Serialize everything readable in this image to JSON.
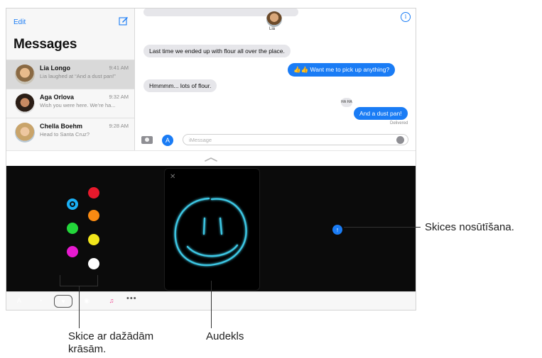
{
  "sidebar": {
    "edit_label": "Edit",
    "title": "Messages",
    "conversations": [
      {
        "name": "Lia Longo",
        "time": "9:41 AM",
        "preview": "Lia laughed at “And a dust pan!”"
      },
      {
        "name": "Aga Orlova",
        "time": "9:32 AM",
        "preview": "Wish you were here. We’re ha..."
      },
      {
        "name": "Chella Boehm",
        "time": "9:28 AM",
        "preview": "Head to Santa Cruz?"
      }
    ]
  },
  "chat": {
    "contact_name": "Lia",
    "messages": [
      {
        "text": "Last time we ended up with flour all over the place.",
        "direction": "in"
      },
      {
        "text": "👍👍 Want me to pick up anything?",
        "direction": "out"
      },
      {
        "text": "Hmmmm... lots of flour.",
        "direction": "in"
      },
      {
        "text": "And a dust pan!",
        "direction": "out"
      }
    ],
    "tapback": "HA HA",
    "status": "Delivered",
    "input_placeholder": "iMessage"
  },
  "drawing": {
    "colors": [
      "#e8192c",
      "#1ab0f5",
      "#f98a12",
      "#23d63a",
      "#f2e61b",
      "#e71ad0",
      "#ffffff"
    ],
    "active_color": "#1ab0f5",
    "stroke_color": "#3ec7e4"
  },
  "drawer_apps": [
    {
      "name": "app-store",
      "color": "#1a7cf5"
    },
    {
      "name": "recents",
      "color": "#36c759"
    },
    {
      "name": "digital-touch",
      "color": "#111111"
    },
    {
      "name": "images-search",
      "color": "#ef3b5b"
    },
    {
      "name": "music",
      "color": "#ffffff"
    }
  ],
  "callouts": {
    "send": "Skices nosūtīšana.",
    "colors": "Skice ar dažādām krāsām.",
    "canvas": "Audekls"
  }
}
